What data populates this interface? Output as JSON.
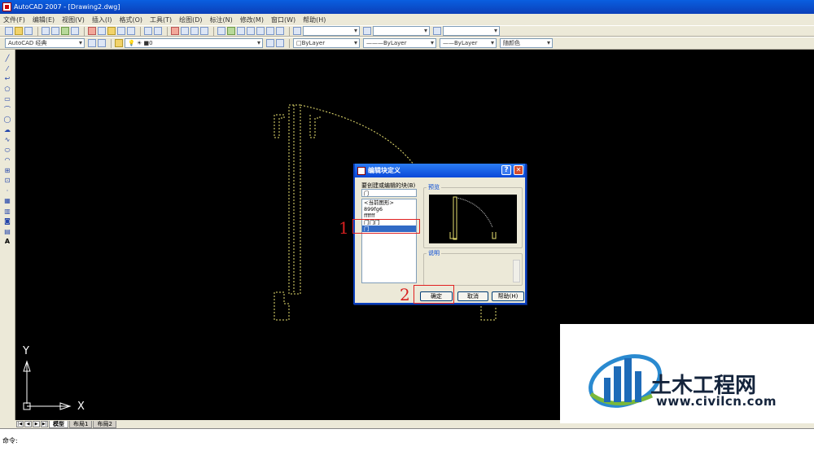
{
  "window": {
    "title": "AutoCAD 2007 - [Drawing2.dwg]"
  },
  "menu": [
    "文件(F)",
    "编辑(E)",
    "视图(V)",
    "插入(I)",
    "格式(O)",
    "工具(T)",
    "绘图(D)",
    "标注(N)",
    "修改(M)",
    "窗口(W)",
    "帮助(H)"
  ],
  "toolbar2": {
    "workspace": "AutoCAD 经典",
    "layer": "0",
    "color": "ByLayer",
    "linetype": "ByLayer",
    "lineweight": "ByLayer",
    "plotstyle": "随颜色"
  },
  "dialog": {
    "title": "编辑块定义",
    "help_glyph": "?",
    "close_glyph": "✕",
    "block_label": "要创建或编辑的块(B)",
    "block_value": "门",
    "list": [
      "<当前图形>",
      "899fg6",
      "ffffff",
      "门门门",
      "门"
    ],
    "selected_index": 4,
    "preview_label": "预览",
    "description_label": "说明",
    "ok_label": "确定",
    "cancel_label": "取消",
    "help_label": "帮助(H)"
  },
  "annotations": {
    "step1": "1",
    "step2": "2"
  },
  "ucs": {
    "x_label": "X",
    "y_label": "Y"
  },
  "tabs": [
    "模型",
    "布局1",
    "布局2"
  ],
  "command": {
    "prompt": "命令:"
  },
  "watermark": {
    "name": "土木工程网",
    "url": "www.civilcn.com"
  },
  "colors": {
    "title_bar": "#0a48d8",
    "dialog_border": "#0a3fbf",
    "annotation_red": "#e02020",
    "dashed_yellow": "#e8e070"
  }
}
